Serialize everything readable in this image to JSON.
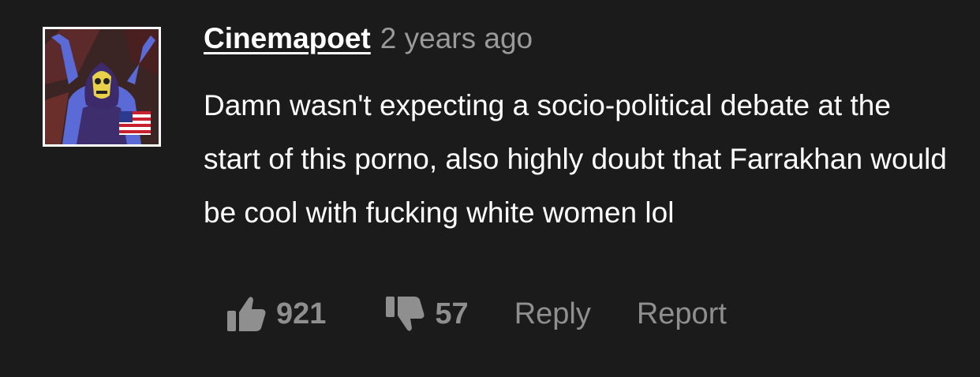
{
  "comment": {
    "username": "Cinemapoet",
    "timestamp": "2 years ago",
    "body": "Damn wasn't expecting a socio-political debate at the start of this porno, also highly doubt that Farrakhan would be cool with fucking white women lol",
    "avatar_icon": "skeletor-avatar-with-us-flag"
  },
  "actions": {
    "upvote_icon": "thumbs-up-icon",
    "upvote_count": "921",
    "downvote_icon": "thumbs-down-icon",
    "downvote_count": "57",
    "reply_label": "Reply",
    "report_label": "Report"
  },
  "colors": {
    "background": "#1b1b1b",
    "text": "#ffffff",
    "muted": "#9a9a9a",
    "action": "#8f8f8f"
  }
}
